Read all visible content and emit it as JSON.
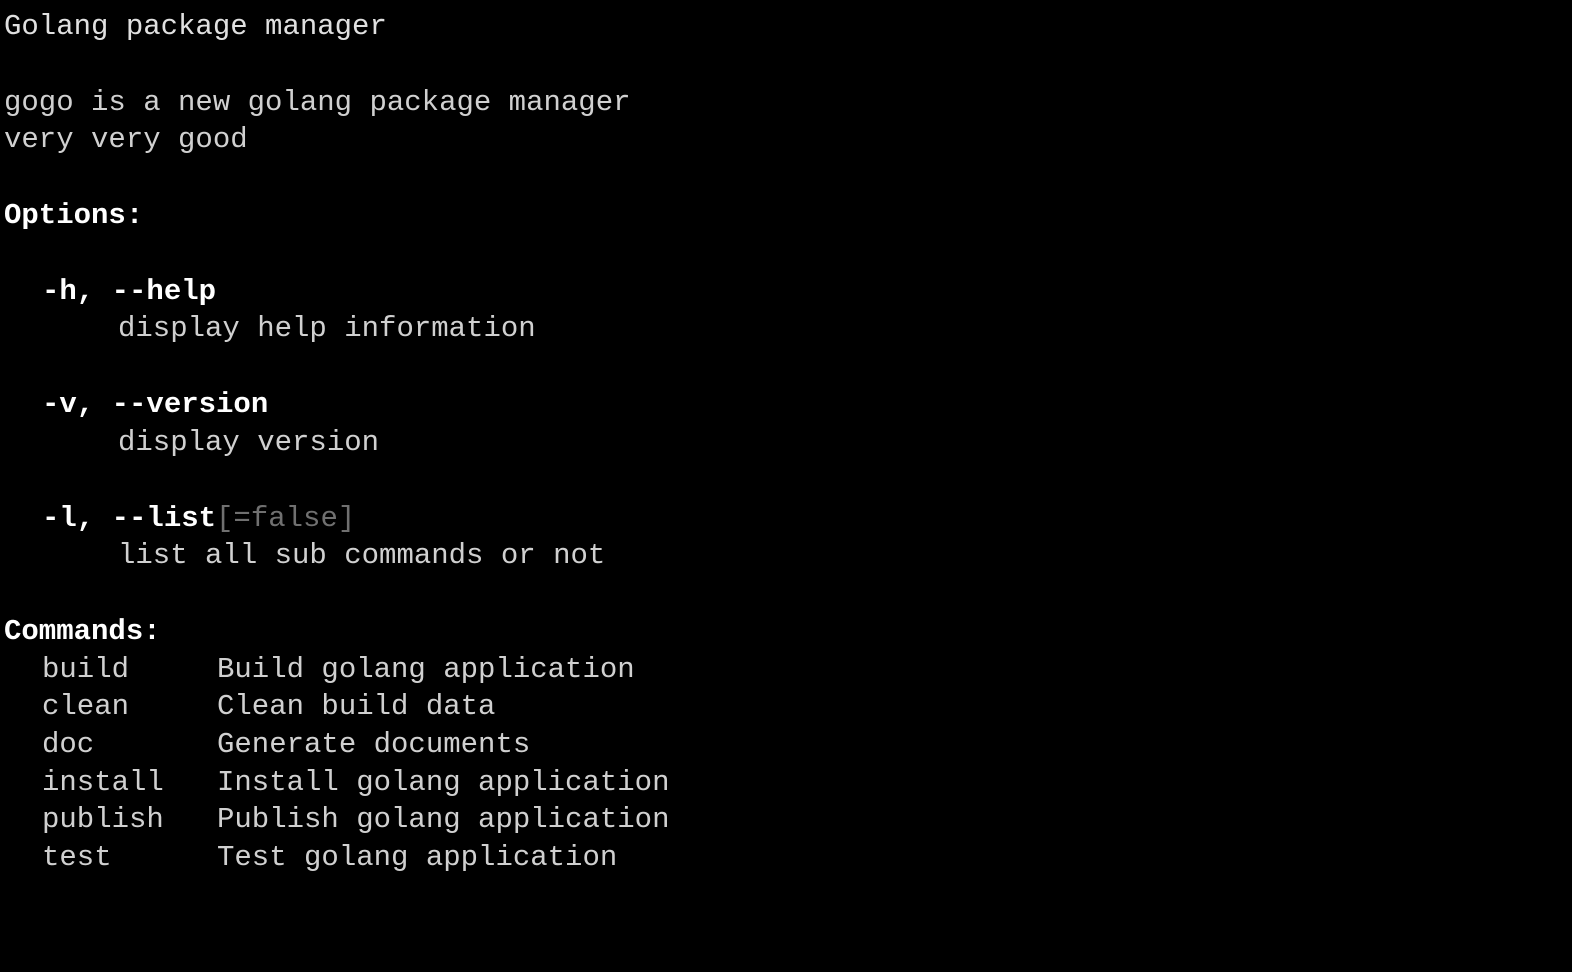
{
  "title": "Golang package manager",
  "description": {
    "line1": "gogo is a new golang package manager",
    "line2": "very very good"
  },
  "sections": {
    "options": "Options:",
    "commands": "Commands:"
  },
  "options": [
    {
      "flag": "-h, --help",
      "default": "",
      "desc": "display help information"
    },
    {
      "flag": "-v, --version",
      "default": "",
      "desc": "display version"
    },
    {
      "flag": "-l, --list",
      "default": "[=false]",
      "desc": "list all sub commands or not"
    }
  ],
  "commands": [
    {
      "name": "build",
      "desc": "Build golang application"
    },
    {
      "name": "clean",
      "desc": "Clean build data"
    },
    {
      "name": "doc",
      "desc": "Generate documents"
    },
    {
      "name": "install",
      "desc": "Install golang application"
    },
    {
      "name": "publish",
      "desc": "Publish golang application"
    },
    {
      "name": "test",
      "desc": "Test golang application"
    }
  ]
}
